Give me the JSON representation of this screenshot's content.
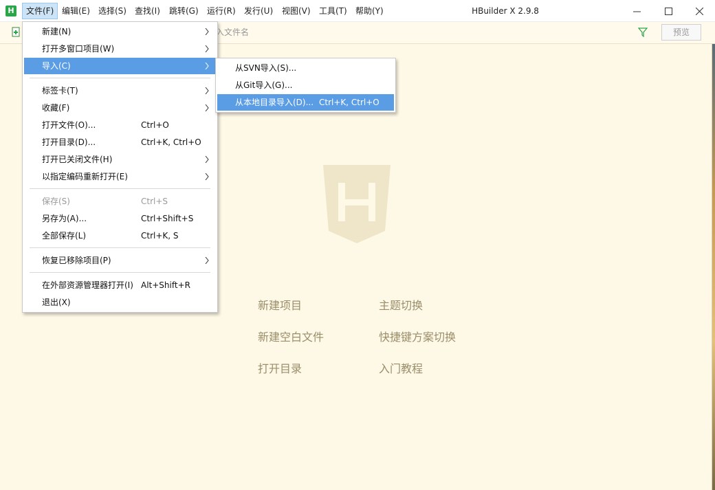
{
  "app": {
    "icon_letter": "H",
    "window_title": "HBuilder X 2.9.8"
  },
  "menubar": [
    {
      "label": "文件(F)"
    },
    {
      "label": "编辑(E)"
    },
    {
      "label": "选择(S)"
    },
    {
      "label": "查找(I)"
    },
    {
      "label": "跳转(G)"
    },
    {
      "label": "运行(R)"
    },
    {
      "label": "发行(U)"
    },
    {
      "label": "视图(V)"
    },
    {
      "label": "工具(T)"
    },
    {
      "label": "帮助(Y)"
    }
  ],
  "toolbar": {
    "search_placeholder": "入文件名",
    "preview_label": "预览"
  },
  "file_menu": {
    "items": [
      {
        "label": "新建(N)",
        "submenu": true
      },
      {
        "label": "打开多窗口项目(W)",
        "submenu": true
      },
      {
        "label": "导入(C)",
        "submenu": true,
        "highlighted": true
      },
      {
        "label": "标签卡(T)",
        "submenu": true
      },
      {
        "label": "收藏(F)",
        "submenu": true
      },
      {
        "label": "打开文件(O)...",
        "shortcut": "Ctrl+O"
      },
      {
        "label": "打开目录(D)...",
        "shortcut": "Ctrl+K, Ctrl+O"
      },
      {
        "label": "打开已关闭文件(H)",
        "submenu": true
      },
      {
        "label": "以指定编码重新打开(E)",
        "submenu": true
      },
      {
        "label": "保存(S)",
        "shortcut": "Ctrl+S",
        "disabled": true
      },
      {
        "label": "另存为(A)...",
        "shortcut": "Ctrl+Shift+S"
      },
      {
        "label": "全部保存(L)",
        "shortcut": "Ctrl+K, S"
      },
      {
        "label": "恢复已移除项目(P)",
        "submenu": true
      },
      {
        "label": "在外部资源管理器打开(I)",
        "shortcut": "Alt+Shift+R"
      },
      {
        "label": "退出(X)"
      }
    ]
  },
  "import_submenu": {
    "items": [
      {
        "label": "从SVN导入(S)..."
      },
      {
        "label": "从Git导入(G)..."
      },
      {
        "label": "从本地目录导入(D)...",
        "shortcut": "Ctrl+K, Ctrl+O",
        "highlighted": true
      }
    ]
  },
  "welcome": {
    "links": [
      {
        "label": "新建项目"
      },
      {
        "label": "主题切换"
      },
      {
        "label": "新建空白文件"
      },
      {
        "label": "快捷键方案切换"
      },
      {
        "label": "打开目录"
      },
      {
        "label": "入门教程"
      }
    ]
  },
  "colors": {
    "highlight": "#5b9de4",
    "background": "#fef8e6",
    "app_icon": "#2aa54a"
  }
}
